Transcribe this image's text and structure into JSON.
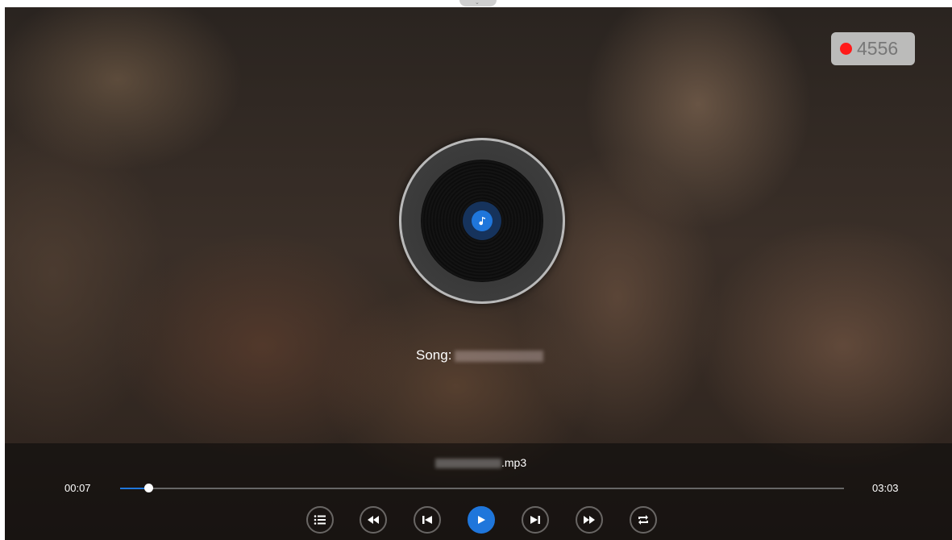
{
  "recording": {
    "count": "4556",
    "dot_color": "#ff1a1a"
  },
  "song": {
    "label": "Song:"
  },
  "file": {
    "extension": ".mp3"
  },
  "progress": {
    "elapsed": "00:07",
    "total": "03:03",
    "fraction": 0.039
  },
  "controls": [
    {
      "icon": "playlist-icon"
    },
    {
      "icon": "rewind-icon"
    },
    {
      "icon": "previous-icon"
    },
    {
      "icon": "play-icon"
    },
    {
      "icon": "next-icon"
    },
    {
      "icon": "fast-forward-icon"
    },
    {
      "icon": "repeat-icon"
    }
  ],
  "colors": {
    "accent": "#1f76db"
  }
}
